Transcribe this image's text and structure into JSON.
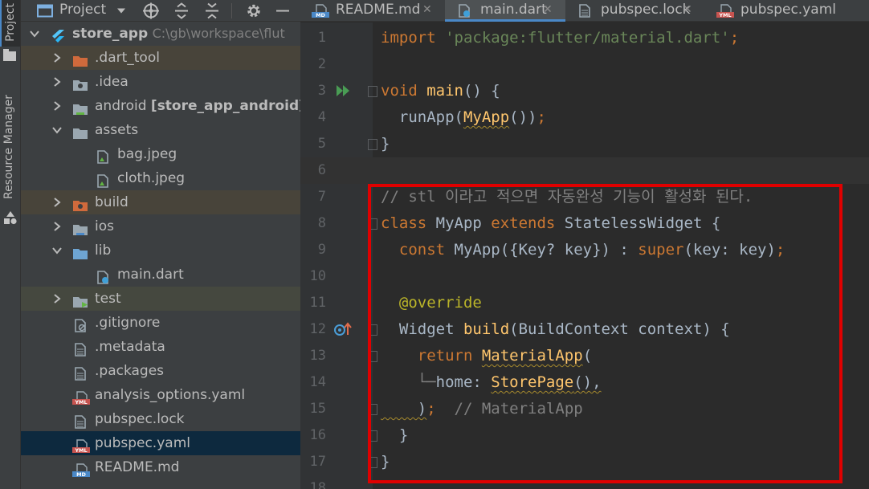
{
  "tool_strip": {
    "project_label": "Project",
    "resource_manager_label": "Resource Manager"
  },
  "project_panel": {
    "title": "Project",
    "tree": [
      {
        "label": "store_app",
        "path": "C:\\gb\\workspace\\flut",
        "bold": true,
        "kind": "flutter-module",
        "depth": 0,
        "expanded": true
      },
      {
        "label": ".dart_tool",
        "kind": "folder-orange",
        "depth": 1,
        "expanded": false,
        "bg": "excluded"
      },
      {
        "label": ".idea",
        "kind": "folder-gear",
        "depth": 1,
        "expanded": false
      },
      {
        "label": "android",
        "suffix": "[store_app_android]",
        "kind": "folder-android",
        "depth": 1,
        "expanded": false
      },
      {
        "label": "assets",
        "kind": "folder",
        "depth": 1,
        "expanded": true
      },
      {
        "label": "bag.jpeg",
        "kind": "image-file",
        "depth": 2
      },
      {
        "label": "cloth.jpeg",
        "kind": "image-file",
        "depth": 2
      },
      {
        "label": "build",
        "kind": "folder-orange-gear",
        "depth": 1,
        "expanded": false,
        "bg": "excluded"
      },
      {
        "label": "ios",
        "kind": "folder-ios",
        "depth": 1,
        "expanded": false
      },
      {
        "label": "lib",
        "kind": "folder-blue",
        "depth": 1,
        "expanded": true
      },
      {
        "label": "main.dart",
        "kind": "dart-file",
        "depth": 2
      },
      {
        "label": "test",
        "kind": "folder-test",
        "depth": 1,
        "expanded": false,
        "bg": "testbg"
      },
      {
        "label": ".gitignore",
        "kind": "ignore-file",
        "depth": 1
      },
      {
        "label": ".metadata",
        "kind": "text-file",
        "depth": 1
      },
      {
        "label": ".packages",
        "kind": "text-file",
        "depth": 1
      },
      {
        "label": "analysis_options.yaml",
        "kind": "yaml-file",
        "depth": 1
      },
      {
        "label": "pubspec.lock",
        "kind": "text-file",
        "depth": 1
      },
      {
        "label": "pubspec.yaml",
        "kind": "yaml-file",
        "depth": 1,
        "selected": true
      },
      {
        "label": "README.md",
        "kind": "md-file",
        "depth": 1
      }
    ]
  },
  "editor_tabs": [
    {
      "label": "README.md",
      "icon": "md-icon",
      "active": false
    },
    {
      "label": "main.dart",
      "icon": "dart-icon",
      "active": true
    },
    {
      "label": "pubspec.lock",
      "icon": "text-file-icon",
      "active": false
    },
    {
      "label": "pubspec.yaml",
      "icon": "yaml-icon",
      "active": false
    }
  ],
  "editor": {
    "current_line": 6,
    "lines": [
      {
        "n": "1",
        "tokens": [
          [
            "kw",
            "import "
          ],
          [
            "str",
            "'package:flutter/material.dart'"
          ],
          [
            "kw",
            ";"
          ]
        ]
      },
      {
        "n": "2",
        "tokens": []
      },
      {
        "n": "3",
        "tokens": [
          [
            "kw",
            "void "
          ],
          [
            "fn",
            "main"
          ],
          [
            "",
            "() {"
          ]
        ],
        "gutter_icon": "run",
        "fold": true
      },
      {
        "n": "4",
        "tokens": [
          [
            "",
            "  runApp("
          ],
          [
            "fn wavy",
            "MyApp"
          ],
          [
            "",
            "())"
          ],
          [
            "kw",
            ";"
          ]
        ]
      },
      {
        "n": "5",
        "tokens": [
          [
            "",
            "}"
          ]
        ],
        "fold": true
      },
      {
        "n": "6",
        "tokens": []
      },
      {
        "n": "7",
        "tokens": [
          [
            "cmt",
            "// stl 이라고 적으면 자동완성 기능이 활성화 된다."
          ]
        ]
      },
      {
        "n": "8",
        "tokens": [
          [
            "kw",
            "class "
          ],
          [
            "cls",
            "MyApp "
          ],
          [
            "kw",
            "extends "
          ],
          [
            "cls",
            "StatelessWidget "
          ],
          [
            "",
            "{"
          ]
        ],
        "fold": true
      },
      {
        "n": "9",
        "tokens": [
          [
            "kw",
            "  const "
          ],
          [
            "",
            "MyApp({Key? key}) : "
          ],
          [
            "kw",
            "super"
          ],
          [
            "",
            "(key: key)"
          ],
          [
            "kw",
            ";"
          ]
        ]
      },
      {
        "n": "10",
        "tokens": []
      },
      {
        "n": "11",
        "tokens": [
          [
            "ann",
            "  @override"
          ]
        ]
      },
      {
        "n": "12",
        "tokens": [
          [
            "",
            "  Widget "
          ],
          [
            "fn",
            "build"
          ],
          [
            "",
            "(BuildContext context) {"
          ]
        ],
        "gutter_icon": "override",
        "fold": true
      },
      {
        "n": "13",
        "tokens": [
          [
            "kw",
            "    return "
          ],
          [
            "fn wavy",
            "MaterialApp"
          ],
          [
            "",
            "("
          ]
        ],
        "fold": true
      },
      {
        "n": "14",
        "tokens": [
          [
            "cmt",
            "    └─"
          ],
          [
            "",
            "home: "
          ],
          [
            "fn wavy",
            "StorePage"
          ],
          [
            "wavy",
            "(),"
          ]
        ]
      },
      {
        "n": "15",
        "tokens": [
          [
            "wavy",
            "    )"
          ],
          [
            "kw",
            ";"
          ],
          [
            "",
            "  "
          ],
          [
            "cmt",
            "// MaterialApp"
          ]
        ],
        "fold": true
      },
      {
        "n": "16",
        "tokens": [
          [
            "",
            "  }"
          ]
        ],
        "fold": true
      },
      {
        "n": "17",
        "tokens": [
          [
            "",
            "}"
          ]
        ],
        "fold": true
      },
      {
        "n": "18",
        "tokens": []
      }
    ]
  },
  "colors": {
    "highlight_box": "#e00000",
    "accent": "#4a88c7"
  }
}
